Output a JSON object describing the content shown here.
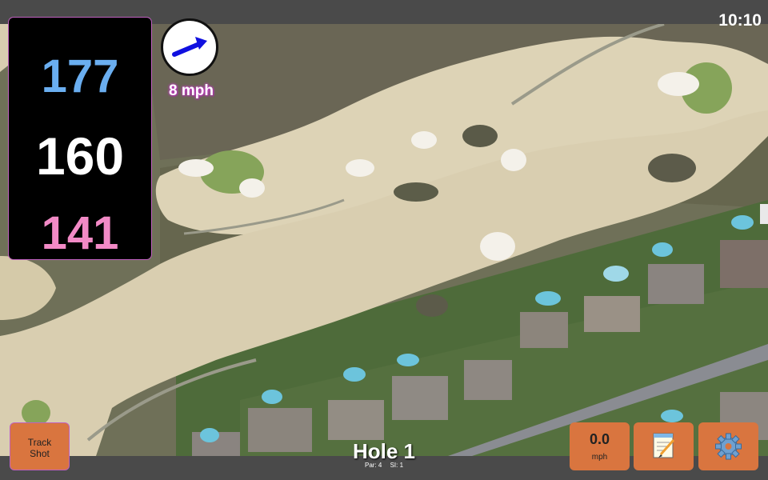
{
  "status_bar": {
    "time": "10:10"
  },
  "distances": {
    "back": "177",
    "middle": "160",
    "front": "141"
  },
  "wind": {
    "speed_label": "8 mph",
    "icon": "wind-arrow-icon",
    "direction": "east-northeast"
  },
  "hole": {
    "title": "Hole 1",
    "par_label": "Par: 4",
    "si_label": "SI: 1"
  },
  "buttons": {
    "track_shot": {
      "line1": "Track",
      "line2": "Shot"
    },
    "speed": {
      "value": "0.0",
      "unit": "mph"
    },
    "notes_icon": "notepad-icon",
    "settings_icon": "gear-icon"
  },
  "colors": {
    "back_distance": "#6aaef0",
    "middle_distance": "#ffffff",
    "front_distance": "#f28ac6",
    "button_orange": "#d9753f",
    "wind_arrow": "#1010e0",
    "bar_gray": "#4a4a4a"
  }
}
